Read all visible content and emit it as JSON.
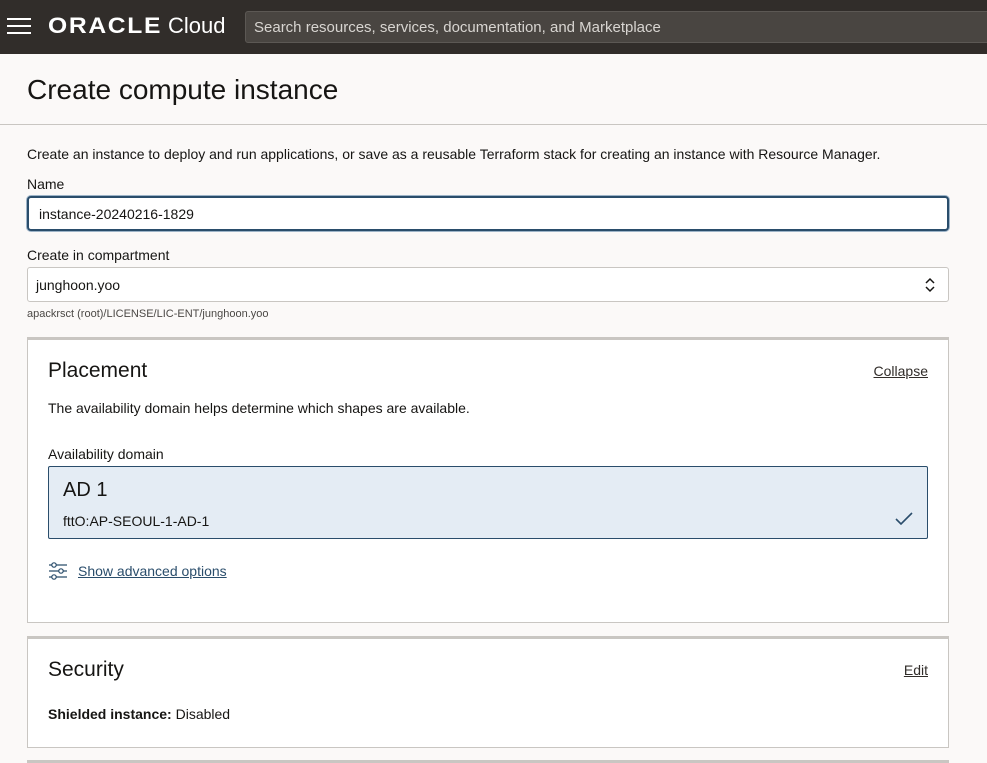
{
  "topbar": {
    "logo_brand": "ORACLE",
    "logo_sub": "Cloud",
    "search_placeholder": "Search resources, services, documentation, and Marketplace"
  },
  "page": {
    "title": "Create compute instance",
    "intro": "Create an instance to deploy and run applications, or save as a reusable Terraform stack for creating an instance with Resource Manager."
  },
  "form": {
    "name_label": "Name",
    "name_value": "instance-20240216-1829",
    "compartment_label": "Create in compartment",
    "compartment_value": "junghoon.yoo",
    "compartment_path": "apackrsct (root)/LICENSE/LIC-ENT/junghoon.yoo"
  },
  "placement": {
    "title": "Placement",
    "collapse_label": "Collapse",
    "description": "The availability domain helps determine which shapes are available.",
    "ad_label": "Availability domain",
    "ad_name": "AD 1",
    "ad_id": "fttO:AP-SEOUL-1-AD-1",
    "advanced_label": "Show advanced options"
  },
  "security": {
    "title": "Security",
    "edit_label": "Edit",
    "shielded_label": "Shielded instance:",
    "shielded_value": "Disabled"
  },
  "colors": {
    "topbar": "#312d2a",
    "accent": "#2a4d6b",
    "selected_bg": "#e4ecf4"
  }
}
